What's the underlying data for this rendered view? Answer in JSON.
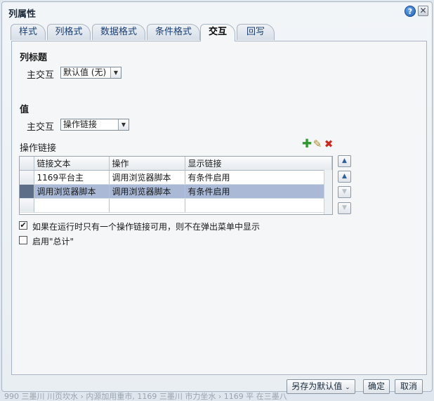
{
  "dialog": {
    "title": "列属性",
    "help_icon": "help-icon",
    "close_icon": "close-icon"
  },
  "tabs": [
    {
      "label": "样式",
      "active": false
    },
    {
      "label": "列格式",
      "active": false
    },
    {
      "label": "数据格式",
      "active": false
    },
    {
      "label": "条件格式",
      "active": false
    },
    {
      "label": "交互",
      "active": true
    },
    {
      "label": "回写",
      "active": false
    }
  ],
  "column_header": {
    "section_title": "列标题",
    "primary_interaction_label": "主交互",
    "primary_interaction_value": "默认值 (无)"
  },
  "value": {
    "section_title": "值",
    "primary_interaction_label": "主交互",
    "primary_interaction_value": "操作链接"
  },
  "action_links": {
    "title": "操作链接",
    "toolbar_icons": [
      "add-icon",
      "edit-icon",
      "delete-icon"
    ],
    "columns": [
      "链接文本",
      "操作",
      "显示链接"
    ],
    "rows": [
      {
        "link_text": "1169平台主",
        "action": "调用浏览器脚本",
        "show_link": "有条件启用",
        "selected": false
      },
      {
        "link_text": "调用浏览器脚本",
        "action": "调用浏览器脚本",
        "show_link": "有条件启用",
        "selected": true
      },
      {
        "link_text": "",
        "action": "",
        "show_link": "",
        "selected": false
      }
    ],
    "move_buttons": [
      {
        "icon": "move-top-icon",
        "glyph": "▲",
        "enabled": true
      },
      {
        "icon": "move-up-icon",
        "glyph": "▲",
        "enabled": true
      },
      {
        "icon": "move-down-icon",
        "glyph": "▼",
        "enabled": false
      },
      {
        "icon": "move-bottom-icon",
        "glyph": "▼",
        "enabled": false
      }
    ]
  },
  "options": {
    "hide_single_link": {
      "label": "如果在运行时只有一个操作链接可用，则不在弹出菜单中显示",
      "checked": true
    },
    "enable_total": {
      "label": "启用\"总计\"",
      "checked": false
    }
  },
  "footer": {
    "save_default_label": "另存为默认值",
    "ok_label": "确定",
    "cancel_label": "取消"
  },
  "background": {
    "status_text": "990 三墨川 川页坎水 › 内源加用重市, 1169 三墨川 市力坐水 › 1169 平 在三墨八"
  }
}
